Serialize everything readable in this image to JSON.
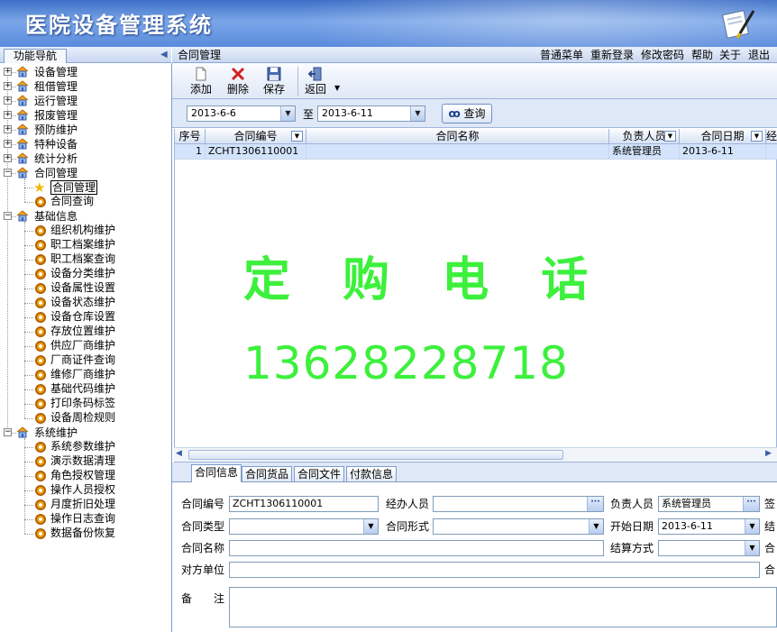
{
  "app": {
    "title": "医院设备管理系统"
  },
  "nav": {
    "tab_label": "功能导航",
    "groups": [
      {
        "label": "设备管理",
        "expanded": false
      },
      {
        "label": "租借管理",
        "expanded": false
      },
      {
        "label": "运行管理",
        "expanded": false
      },
      {
        "label": "报废管理",
        "expanded": false
      },
      {
        "label": "预防维护",
        "expanded": false
      },
      {
        "label": "特种设备",
        "expanded": false
      },
      {
        "label": "统计分析",
        "expanded": false
      },
      {
        "label": "合同管理",
        "expanded": true,
        "children": [
          "合同管理",
          "合同查询"
        ]
      },
      {
        "label": "基础信息",
        "expanded": true,
        "children": [
          "组织机构维护",
          "职工档案维护",
          "职工档案查询",
          "设备分类维护",
          "设备属性设置",
          "设备状态维护",
          "设备仓库设置",
          "存放位置维护",
          "供应厂商维护",
          "厂商证件查询",
          "维修厂商维护",
          "基础代码维护",
          "打印条码标签",
          "设备周检规则"
        ]
      },
      {
        "label": "系统维护",
        "expanded": true,
        "children": [
          "系统参数维护",
          "演示数据清理",
          "角色授权管理",
          "操作人员授权",
          "月度折旧处理",
          "操作日志查询",
          "数据备份恢复"
        ]
      }
    ]
  },
  "crumb": {
    "page": "合同管理"
  },
  "topmenu": [
    "普通菜单",
    "重新登录",
    "修改密码",
    "帮助",
    "关于",
    "退出"
  ],
  "toolbar": {
    "add": "添加",
    "delete": "删除",
    "save": "保存",
    "back": "返回"
  },
  "filter": {
    "from": "2013-6-6",
    "to_label": "至",
    "to": "2013-6-11",
    "query": "查询"
  },
  "grid": {
    "headers": [
      "序号",
      "合同编号",
      "合同名称",
      "负责人员",
      "合同日期",
      "经"
    ],
    "rows": [
      [
        "1",
        "ZCHT1306110001",
        "",
        "系统管理员",
        "2013-6-11",
        ""
      ]
    ]
  },
  "watermark": {
    "line1": "定 购 电 话",
    "line2": "13628228718"
  },
  "detail_tabs": [
    "合同信息",
    "合同货品",
    "合同文件",
    "付款信息"
  ],
  "form": {
    "contract_no_label": "合同编号",
    "contract_no": "ZCHT1306110001",
    "handler_label": "经办人员",
    "handler": "",
    "owner_label": "负责人员",
    "owner": "系统管理员",
    "sign_label": "签",
    "type_label": "合同类型",
    "type": "",
    "form_label": "合同形式",
    "form": "",
    "start_label": "开始日期",
    "start": "2013-6-11",
    "end_label": "结",
    "name_label": "合同名称",
    "name": "",
    "settle_label": "结算方式",
    "settle": "",
    "amount_label": "合",
    "party_label": "对方单位",
    "party": "",
    "party_tail_label": "合",
    "remark_label": "备　　注",
    "remark": ""
  },
  "colors": {
    "banner": "#5b8bdc",
    "accent": "#7f9ccc",
    "watermark": "#3cf03c"
  }
}
